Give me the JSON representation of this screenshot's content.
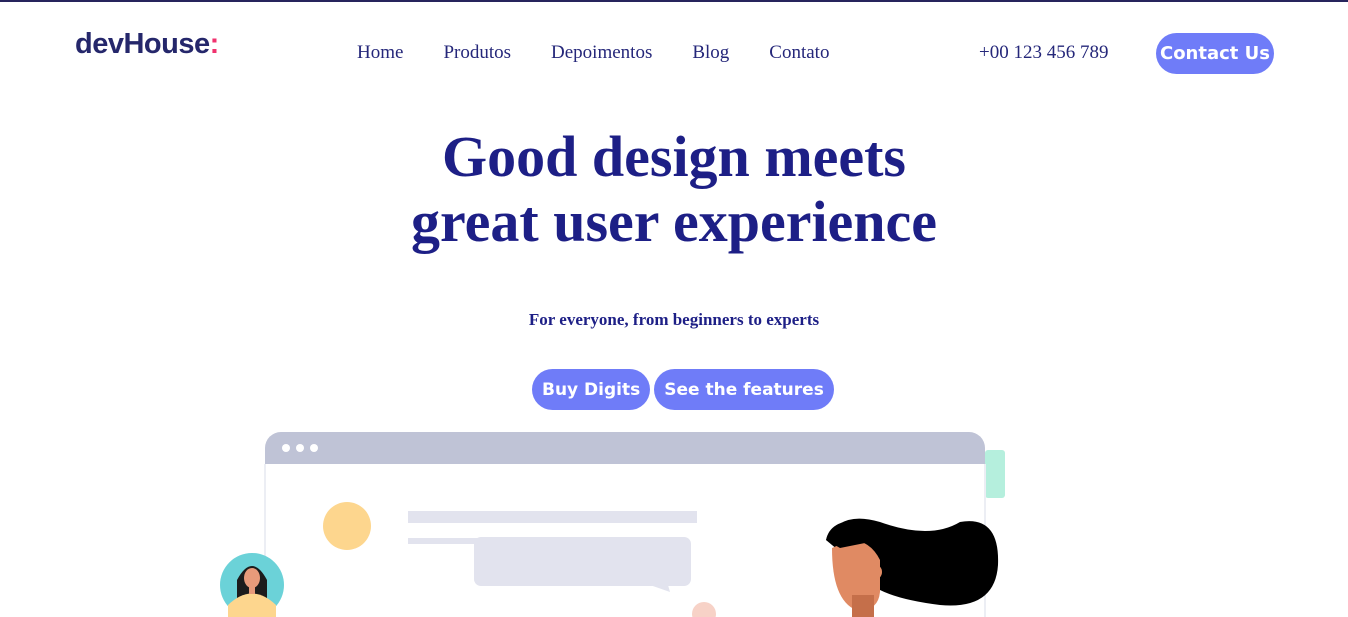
{
  "header": {
    "logo_text": "devHouse",
    "logo_colon": ":",
    "nav": [
      {
        "label": "Home"
      },
      {
        "label": "Produtos"
      },
      {
        "label": "Depoimentos"
      },
      {
        "label": "Blog"
      },
      {
        "label": "Contato"
      }
    ],
    "phone": "+00 123 456 789",
    "contact_label": "Contact Us"
  },
  "hero": {
    "title_line1": "Good design meets",
    "title_line2": "great user experience",
    "subtitle": "For everyone, from beginners to experts",
    "buy_label": "Buy Digits",
    "features_label": "See the features"
  },
  "colors": {
    "primary_text": "#1d1f86",
    "button": "#6f7cf8",
    "logo_accent": "#f0326e",
    "browser_bar": "#bfc3d6"
  },
  "illustration": {
    "icons": [
      "browser-window-illustration",
      "woman-avatar-illustration",
      "woman-with-hair-illustration"
    ]
  }
}
